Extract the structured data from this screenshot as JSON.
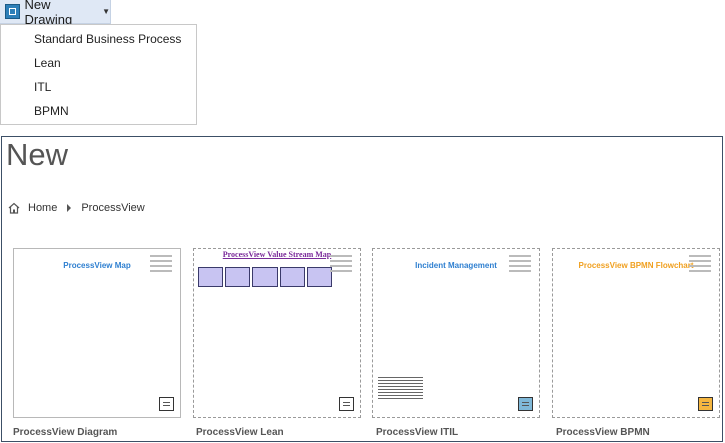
{
  "toolbar": {
    "new_drawing_label": "New Drawing",
    "icon": "drawing-app-icon"
  },
  "menu": {
    "items": [
      "Standard Business Process",
      "Lean",
      "ITL",
      "BPMN"
    ]
  },
  "panel": {
    "title": "New",
    "breadcrumb": [
      "Home",
      "ProcessView"
    ]
  },
  "templates": [
    {
      "label": "ProcessView Diagram",
      "thumb_title": "ProcessView Map",
      "thumb_color": "#2e7fd0"
    },
    {
      "label": "ProcessView Lean",
      "thumb_title": "ProcessView Value Stream Map",
      "thumb_color": "#7a2a9a"
    },
    {
      "label": "ProcessView ITIL",
      "thumb_title": "Incident Management",
      "thumb_color": "#2e7fd0"
    },
    {
      "label": "ProcessView BPMN",
      "thumb_title": "ProcessView BPMN Flowchart",
      "thumb_color": "#f0a020"
    }
  ]
}
